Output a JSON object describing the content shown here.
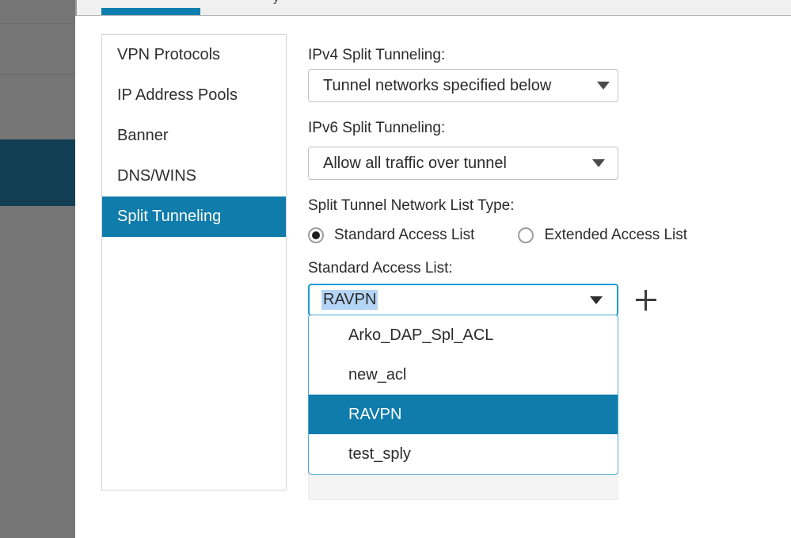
{
  "window": {
    "tab_ghost_text": "y"
  },
  "nav_rail": {
    "items": [
      {
        "name": "rail-item-1",
        "active": false
      },
      {
        "name": "rail-item-2",
        "active": false
      },
      {
        "name": "rail-item-3",
        "active": false
      },
      {
        "name": "rail-item-4",
        "active": true
      },
      {
        "name": "rail-item-5",
        "active": false
      }
    ]
  },
  "section_list": {
    "items": [
      {
        "label": "VPN Protocols",
        "selected": false
      },
      {
        "label": "IP Address Pools",
        "selected": false
      },
      {
        "label": "Banner",
        "selected": false
      },
      {
        "label": "DNS/WINS",
        "selected": false
      },
      {
        "label": "Split Tunneling",
        "selected": true
      }
    ]
  },
  "form": {
    "ipv4_label": "IPv4 Split Tunneling:",
    "ipv4_value": "Tunnel networks specified below",
    "ipv6_label": "IPv6 Split Tunneling:",
    "ipv6_value": "Allow all traffic over tunnel",
    "list_type_label": "Split Tunnel Network List Type:",
    "radio_standard": "Standard Access List",
    "radio_extended": "Extended Access List",
    "standard_acl_label": "Standard Access List:",
    "standard_acl_value": "RAVPN",
    "add_icon": "plus-icon"
  },
  "dropdown": {
    "options": [
      {
        "label": "Arko_DAP_Spl_ACL",
        "highlighted": false
      },
      {
        "label": "new_acl",
        "highlighted": false
      },
      {
        "label": "RAVPN",
        "highlighted": true
      },
      {
        "label": "test_sply",
        "highlighted": false
      }
    ]
  },
  "colors": {
    "accent_blue": "#0f7cab",
    "focus_blue": "#1a9ad6",
    "nav_active": "#133f55",
    "nav_bg": "#767676",
    "selection_blue": "#b4d5f5"
  }
}
